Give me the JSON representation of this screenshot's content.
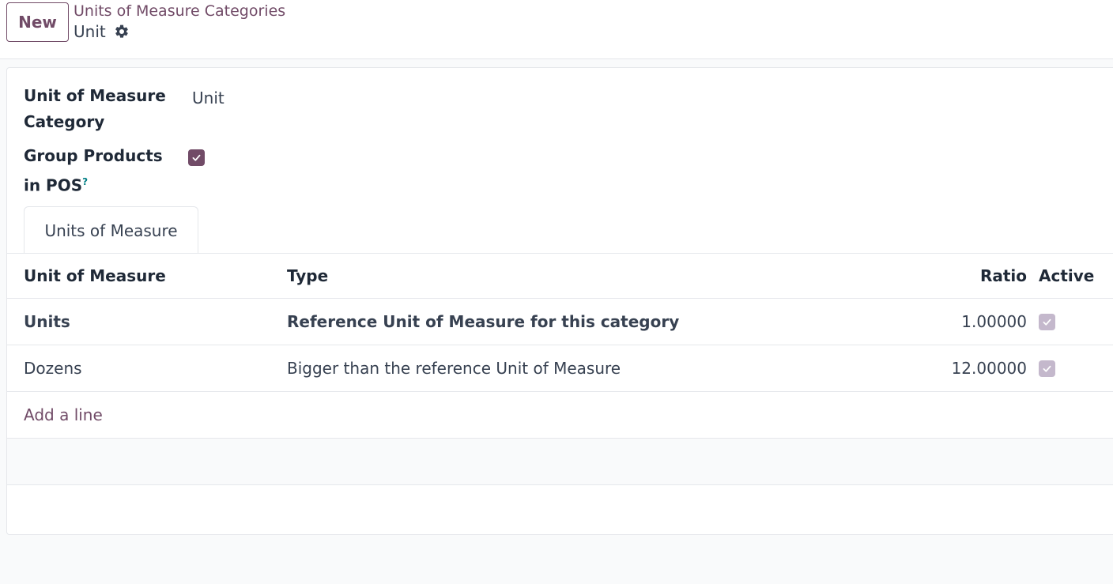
{
  "control_panel": {
    "new_label": "New",
    "breadcrumb": "Units of Measure Categories",
    "record_name": "Unit",
    "gear_icon": "gear-icon"
  },
  "form": {
    "category_label": "Unit of Measure Category",
    "category_value": "Unit",
    "group_label": "Group Products in POS",
    "group_help": "?",
    "group_checked": true
  },
  "tab": {
    "label": "Units of Measure"
  },
  "table": {
    "headers": [
      "Unit of Measure",
      "Type",
      "Ratio",
      "Active"
    ],
    "rows": [
      {
        "uom": "Units",
        "type": "Reference Unit of Measure for this category",
        "ratio": "1.00000",
        "active": true
      },
      {
        "uom": "Dozens",
        "type": "Bigger than the reference Unit of Measure",
        "ratio": "12.00000",
        "active": true
      }
    ],
    "add_line": "Add a line"
  },
  "colors": {
    "accent": "#714b67",
    "help": "#017e84",
    "text": "#374151"
  }
}
